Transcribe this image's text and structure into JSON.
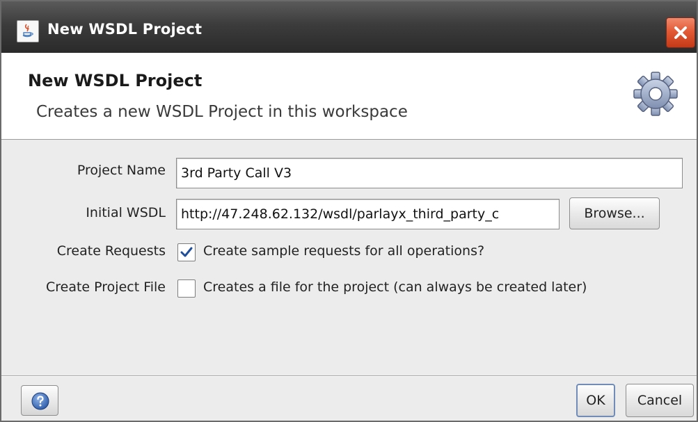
{
  "window": {
    "title": "New WSDL Project",
    "app_icon": "java-app-icon",
    "close_icon": "close-icon"
  },
  "header": {
    "title": "New WSDL Project",
    "description": "Creates a new WSDL Project in this workspace",
    "icon": "gear-icon"
  },
  "form": {
    "project_name": {
      "label": "Project Name",
      "value": "3rd Party Call V3"
    },
    "initial_wsdl": {
      "label": "Initial WSDL",
      "value": "http://47.248.62.132/wsdl/parlayx_third_party_c",
      "browse_label": "Browse..."
    },
    "create_requests": {
      "label": "Create Requests",
      "checked": true,
      "text": "Create sample requests for all operations?"
    },
    "create_project_file": {
      "label": "Create Project File",
      "checked": false,
      "text": "Creates a file for the project (can always be created later)"
    }
  },
  "footer": {
    "help_icon": "help-icon",
    "ok_label": "OK",
    "cancel_label": "Cancel"
  },
  "colors": {
    "titlebar": "#3c3c3c",
    "close_button": "#e25a36",
    "dialog_background": "#ececec",
    "header_background": "#ffffff",
    "checkmark": "#1f4f9a",
    "default_button_border": "#6f8db8"
  }
}
